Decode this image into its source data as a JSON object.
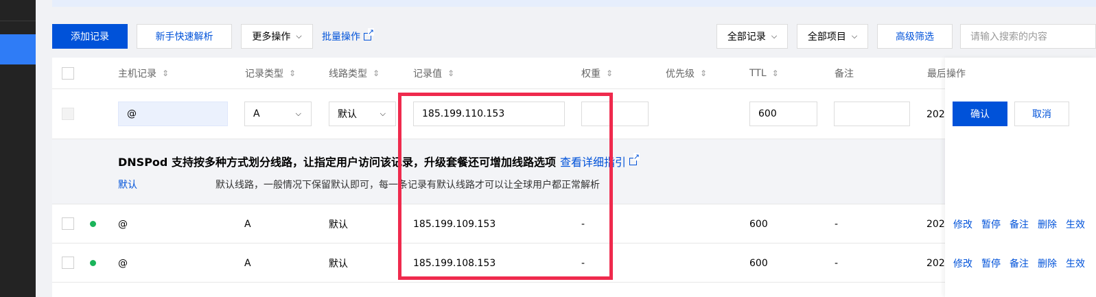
{
  "toolbar": {
    "add_record": "添加记录",
    "quick_resolve": "新手快速解析",
    "more_ops": "更多操作",
    "batch_ops": "批量操作",
    "all_records": "全部记录",
    "all_projects": "全部项目",
    "advanced_filter": "高级筛选",
    "search_placeholder": "请输入搜索的内容"
  },
  "columns": {
    "host": "主机记录",
    "type": "记录类型",
    "line": "线路类型",
    "value": "记录值",
    "weight": "权重",
    "priority": "优先级",
    "ttl": "TTL",
    "remark": "备注",
    "last": "最后",
    "ops": "操作"
  },
  "edit_row": {
    "host": "@",
    "type": "A",
    "line": "默认",
    "value": "185.199.110.153",
    "weight": "",
    "ttl": "600",
    "remark": "",
    "last": "202",
    "confirm": "确认",
    "cancel": "取消"
  },
  "tip": {
    "title": "DNSPod 支持按多种方式划分线路，让指定用户访问该记录，升级套餐还可增加线路选项",
    "guide_link": "查看详细指引",
    "line_name": "默认",
    "line_desc": "默认线路，一般情况下保留默认即可，每一条记录有默认线路才可以让全球用户都正常解析"
  },
  "rows": [
    {
      "host": "@",
      "type": "A",
      "line": "默认",
      "value": "185.199.109.153",
      "weight": "-",
      "ttl": "600",
      "remark": "-",
      "last": "202"
    },
    {
      "host": "@",
      "type": "A",
      "line": "默认",
      "value": "185.199.108.153",
      "weight": "-",
      "ttl": "600",
      "remark": "-",
      "last": "202"
    }
  ],
  "row_ops": [
    "修改",
    "暂停",
    "备注",
    "删除",
    "生效"
  ],
  "colors": {
    "primary": "#0052d9",
    "status_on": "#1ab45a",
    "highlight": "#ef2a4d"
  }
}
